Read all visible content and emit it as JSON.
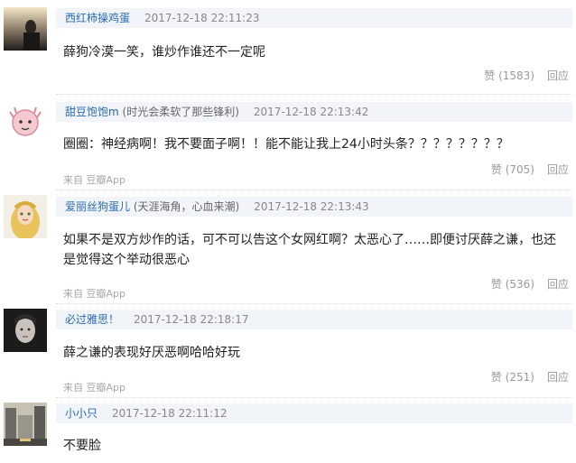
{
  "comments": [
    {
      "username": "西红柿操鸡蛋",
      "tagline": "",
      "time": "2017-12-18 22:11:23",
      "text": "薛狗冷漠一笑，谁炒作谁还不一定呢",
      "likes": "赞 (1583)",
      "reply": "回应",
      "source": ""
    },
    {
      "username": "甜豆饱饱m",
      "tagline": "(时光会柔软了那些锋利)",
      "time": "2017-12-18 22:13:42",
      "text": "圈圈：神经病啊！我不要面子啊！！能不能让我上24小时头条？？？？？？？？",
      "likes": "赞 (705)",
      "reply": "回应",
      "source": "来自 豆瓣App"
    },
    {
      "username": "爱丽丝狗蛋儿",
      "tagline": "(天涯海角，心血来潮)",
      "time": "2017-12-18 22:13:43",
      "text": "如果不是双方炒作的话，可不可以告这个女网红啊？太恶心了……即便讨厌薛之谦，也还是觉得这个举动很恶心",
      "likes": "赞 (536)",
      "reply": "回应",
      "source": "来自 豆瓣App"
    },
    {
      "username": "必过雅思！",
      "tagline": "",
      "time": "2017-12-18 22:18:17",
      "text": "薛之谦的表现好厌恶啊哈哈好玩",
      "likes": "赞 (251)",
      "reply": "回应",
      "source": "来自 豆瓣App"
    },
    {
      "username": "小小只",
      "tagline": "",
      "time": "2017-12-18 22:11:12",
      "text": "不要脸",
      "likes": "",
      "reply": "",
      "source": ""
    }
  ]
}
